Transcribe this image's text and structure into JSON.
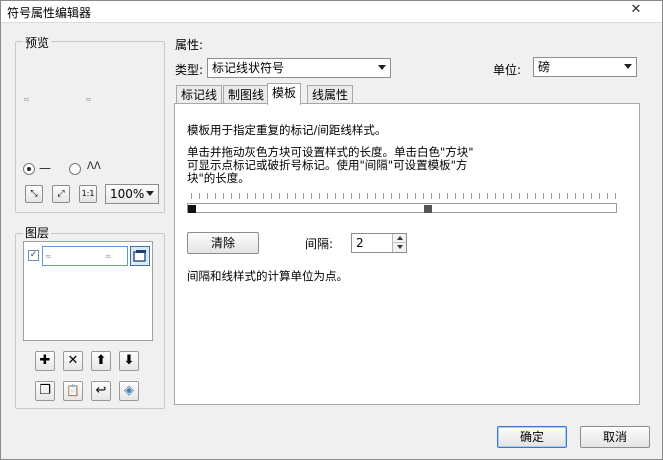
{
  "window": {
    "title": "符号属性编辑器",
    "close_glyph": "✕"
  },
  "preview": {
    "group_label": "预览",
    "line_option_glyph": "—",
    "wave_option_glyph": "ᐱᐱ",
    "zoom_options_selected": "100%",
    "fit_glyph": "⤡",
    "expand_glyph": "⤢",
    "actual_size_glyph": "1:1",
    "symbol_glyph": "≈"
  },
  "layers": {
    "group_label": "图层",
    "check_glyph": "✓",
    "symbol_glyph": "≈",
    "add_glyph": "✚",
    "delete_glyph": "✕",
    "up_glyph": "⬆",
    "down_glyph": "⬇",
    "copy_glyph": "❐",
    "paste_glyph": "📋",
    "undo_glyph": "↩",
    "tag_glyph": "◈"
  },
  "properties": {
    "label": "属性:",
    "type_label": "类型:",
    "type_value": "标记线状符号",
    "unit_label": "单位:",
    "unit_value": "磅"
  },
  "tabs": [
    {
      "label": "标记线"
    },
    {
      "label": "制图线"
    },
    {
      "label": "模板"
    },
    {
      "label": "线属性"
    }
  ],
  "template_tab": {
    "description": "模板用于指定重复的标记/间距线样式。",
    "instructions_line1": "单击并拖动灰色方块可设置样式的长度。单击白色\"方块\"",
    "instructions_line2": "可显示点标记或破折号标记。使用\"间隔\"可设置模板\"方",
    "instructions_line3": "块\"的长度。",
    "clear_button": "清除",
    "interval_label": "间隔:",
    "interval_value": "2",
    "units_note": "间隔和线样式的计算单位为点。"
  },
  "footer": {
    "ok_button": "确定",
    "cancel_button": "取消"
  },
  "colors": {
    "accent": "#3a78c2",
    "block_dark": "#111111",
    "block_gray": "#555555"
  }
}
